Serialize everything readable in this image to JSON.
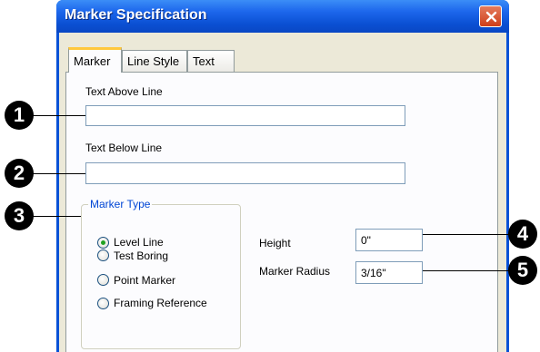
{
  "dialog": {
    "title": "Marker Specification"
  },
  "tabs": [
    {
      "label": "Marker"
    },
    {
      "label": "Line Style"
    },
    {
      "label": "Text"
    }
  ],
  "fields": {
    "text_above": {
      "label": "Text Above Line",
      "value": ""
    },
    "text_below": {
      "label": "Text Below Line",
      "value": ""
    },
    "height": {
      "label": "Height",
      "value": "0\""
    },
    "marker_radius": {
      "label": "Marker Radius",
      "value": "3/16\""
    }
  },
  "marker_type": {
    "legend": "Marker Type",
    "selected": "Level Line",
    "options": [
      {
        "label": "Level Line"
      },
      {
        "label": "Test Boring"
      },
      {
        "label": "Point Marker"
      },
      {
        "label": "Framing Reference"
      }
    ]
  },
  "callouts": [
    {
      "number": "1"
    },
    {
      "number": "2"
    },
    {
      "number": "3"
    },
    {
      "number": "4"
    },
    {
      "number": "5"
    }
  ],
  "colors": {
    "titlebar": "#0a4fd2",
    "dialog_bg": "#ece9d8",
    "active_tab_accent": "#ffc83c",
    "group_legend": "#0046d5",
    "radio_dot": "#21a121"
  },
  "icons": {
    "close": "close-icon"
  }
}
